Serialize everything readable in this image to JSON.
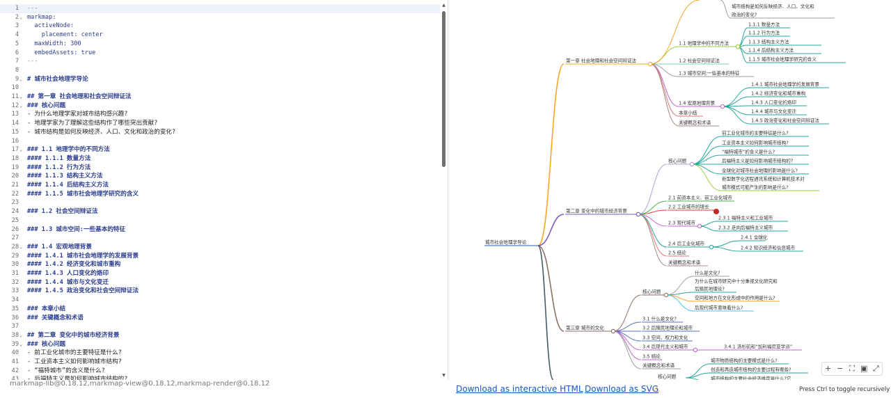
{
  "editor": {
    "lines": [
      {
        "n": "1",
        "fold": "",
        "parts": [
          [
            "dash",
            "---"
          ]
        ]
      },
      {
        "n": "2",
        "fold": "⌄",
        "parts": [
          [
            "yk",
            "markmap:"
          ]
        ]
      },
      {
        "n": "3",
        "fold": "",
        "parts": [
          [
            "yk",
            "  activeNode:"
          ]
        ]
      },
      {
        "n": "4",
        "fold": "",
        "parts": [
          [
            "yk",
            "    placement: center"
          ]
        ]
      },
      {
        "n": "5",
        "fold": "",
        "parts": [
          [
            "yk",
            "  maxWidth: 300"
          ]
        ]
      },
      {
        "n": "6",
        "fold": "",
        "parts": [
          [
            "yk",
            "  embedAssets: true"
          ]
        ]
      },
      {
        "n": "7",
        "fold": "",
        "parts": [
          [
            "dash",
            "---"
          ]
        ]
      },
      {
        "n": "8",
        "fold": "",
        "parts": []
      },
      {
        "n": "9",
        "fold": "⌄",
        "parts": [
          [
            "hd",
            "# 城市社会地理学导论"
          ]
        ]
      },
      {
        "n": "10",
        "fold": "",
        "parts": []
      },
      {
        "n": "11",
        "fold": "⌄",
        "parts": [
          [
            "hd",
            "## 第一章 社会地理和社会空间辩证法"
          ]
        ]
      },
      {
        "n": "12",
        "fold": "⌄",
        "parts": [
          [
            "hd",
            "### 核心问题"
          ]
        ]
      },
      {
        "n": "13",
        "fold": "",
        "parts": [
          [
            "txt",
            "- 为什么地理学家对城市结构感兴趣?"
          ]
        ]
      },
      {
        "n": "14",
        "fold": "",
        "parts": [
          [
            "txt",
            "- 地理学家为了理解这些结构作了哪些突出贡献?"
          ]
        ]
      },
      {
        "n": "15",
        "fold": "",
        "parts": [
          [
            "txt",
            "- 城市结构是如何反映经济、人口、文化和政治的变化?"
          ]
        ]
      },
      {
        "n": "16",
        "fold": "",
        "parts": []
      },
      {
        "n": "17",
        "fold": "⌄",
        "parts": [
          [
            "hd",
            "### 1.1 地理学中的不同方法"
          ]
        ]
      },
      {
        "n": "18",
        "fold": "",
        "parts": [
          [
            "hd",
            "#### 1.1.1 数量方法"
          ]
        ]
      },
      {
        "n": "19",
        "fold": "",
        "parts": [
          [
            "hd",
            "#### 1.1.2 行为方法"
          ]
        ]
      },
      {
        "n": "20",
        "fold": "",
        "parts": [
          [
            "hd",
            "#### 1.1.3 结构主义方法"
          ]
        ]
      },
      {
        "n": "21",
        "fold": "",
        "parts": [
          [
            "hd",
            "#### 1.1.4 后结构主义方法"
          ]
        ]
      },
      {
        "n": "22",
        "fold": "",
        "parts": [
          [
            "hd",
            "#### 1.1.5 城市社会地理学研究的含义"
          ]
        ]
      },
      {
        "n": "23",
        "fold": "",
        "parts": []
      },
      {
        "n": "24",
        "fold": "",
        "parts": [
          [
            "hd",
            "### 1.2 社会空间辩证法"
          ]
        ]
      },
      {
        "n": "25",
        "fold": "",
        "parts": []
      },
      {
        "n": "26",
        "fold": "",
        "parts": [
          [
            "hd",
            "### 1.3 城市空间:一些基本的特征"
          ]
        ]
      },
      {
        "n": "27",
        "fold": "",
        "parts": []
      },
      {
        "n": "28",
        "fold": "⌄",
        "parts": [
          [
            "hd",
            "### 1.4 宏观地理背景"
          ]
        ]
      },
      {
        "n": "29",
        "fold": "",
        "parts": [
          [
            "hd",
            "#### 1.4.1 城市社会地理学的发展背景"
          ]
        ]
      },
      {
        "n": "30",
        "fold": "",
        "parts": [
          [
            "hd",
            "#### 1.4.2 经济变化和城市重构"
          ]
        ]
      },
      {
        "n": "31",
        "fold": "",
        "parts": [
          [
            "hd",
            "#### 1.4.3 人口变化的烙印"
          ]
        ]
      },
      {
        "n": "32",
        "fold": "",
        "parts": [
          [
            "hd",
            "#### 1.4.4 城市与文化变迁"
          ]
        ]
      },
      {
        "n": "33",
        "fold": "",
        "parts": [
          [
            "hd",
            "#### 1.4.5 政治变化和社会空间辩证法"
          ]
        ]
      },
      {
        "n": "34",
        "fold": "",
        "parts": []
      },
      {
        "n": "35",
        "fold": "",
        "parts": [
          [
            "hd",
            "### 本章小结"
          ]
        ]
      },
      {
        "n": "36",
        "fold": "",
        "parts": [
          [
            "hd",
            "### 关键概念和术语"
          ]
        ]
      },
      {
        "n": "37",
        "fold": "",
        "parts": []
      },
      {
        "n": "38",
        "fold": "⌄",
        "parts": [
          [
            "hd",
            "## 第二章 变化中的城市经济背景"
          ]
        ]
      },
      {
        "n": "39",
        "fold": "⌄",
        "parts": [
          [
            "hd",
            "### 核心问题"
          ]
        ]
      },
      {
        "n": "40",
        "fold": "",
        "parts": [
          [
            "txt",
            "- 前工业化城市的主要特征是什么?"
          ]
        ]
      },
      {
        "n": "41",
        "fold": "",
        "parts": [
          [
            "txt",
            "- 工业资本主义如何影响城市结构?"
          ]
        ]
      },
      {
        "n": "42",
        "fold": "",
        "parts": [
          [
            "txt",
            "- “福特城市”的含义是什么?"
          ]
        ]
      },
      {
        "n": "43",
        "fold": "",
        "parts": [
          [
            "txt",
            "- 后福特主义是如何影响城市结构的?"
          ]
        ]
      }
    ]
  },
  "mindmap": {
    "root": "城市社会地理学导论",
    "ch1": "第一章 社会地理和社会空间辩证法",
    "ch1_q3": "城市结构是如何反映经济、人口、文化和",
    "ch1_q3b": "政治的变化?",
    "s11": "1.1 地理学中的不同方法",
    "s111": "1.1.1 数量方法",
    "s112": "1.1.2 行为方法",
    "s113": "1.1.3 结构主义方法",
    "s114": "1.1.4 后结构主义方法",
    "s115": "1.1.5 城市社会地理学研究的含义",
    "s12": "1.2 社会空间辩证法",
    "s13": "1.3 城市空间:一些基本的特征",
    "s14": "1.4 宏观地理背景",
    "s141": "1.4.1 城市社会地理学的发展背景",
    "s142": "1.4.2 经济变化和城市重构",
    "s143": "1.4.3 人口变化的烙印",
    "s144": "1.4.4 城市与文化变迁",
    "s145": "1.4.5 政治变化和社会空间辩证法",
    "s1sum": "本章小结",
    "s1key": "关键概念和术语",
    "ch2": "第二章 变化中的城市经济背景",
    "c2core": "核心问题",
    "c2q1": "前工业化城市的主要特征是什么?",
    "c2q2": "工业资本主义如何影响城市结构?",
    "c2q3": "“福特城市”的含义是什么?",
    "c2q4": "后福特主义是如何影响城市结构的?",
    "c2q5": "全球化对城市社会地理的影响是什么?",
    "c2q6a": "新型数字化远程通讯系统和计算机技术对",
    "c2q6b": "城市模式可能产生的影响是什么?",
    "s21": "2.1 前资本主义、前工业化城市",
    "s22": "2.2 工业城市的增长",
    "s23": "2.3 现代城市",
    "s231": "2.3.1 福特主义和工业城市",
    "s232": "2.3.2 走向后福特主义城市",
    "s24": "2.4 后工业化城市",
    "s241": "2.4.1 全球化",
    "s242": "2.4.2 知识经济和信息城市",
    "s25": "2.5 结论",
    "s2key": "关键概念和术语",
    "ch3": "第三章 城市的文化",
    "c3core": "核心问题",
    "c3q1": "什么是文化?",
    "c3q2a": "为什么在城市研究中十分重视文化研究和",
    "c3q2b": "后殖民地理论?",
    "c3q3": "空间和地方在文化形成中的作用是什么?",
    "c3q4": "后现代城市意味着什么?",
    "s31": "3.1 什么是文化?",
    "s32": "3.2 后殖民地理论和城市",
    "s33": "3.3 空间、权力和文化",
    "s34": "3.4 后现代主义和城市",
    "s341": "3.4.1 洛杉矶和“加利福尼亚学派”",
    "s35": "3.5 结论",
    "s3key": "关键概念和术语",
    "c4core": "核心问题",
    "c4q1": "城市物质结构的主要模式是什么?",
    "c4q2": "创造和再造城市结构的主要过程有哪些?",
    "c4q3": "城市结构的主要社会经济维度是什么?它"
  },
  "toolbar": {
    "zoom_in": "+",
    "zoom_out": "−",
    "fit": "⛶",
    "toggle": "▣",
    "fullscreen": "⤢"
  },
  "footer": {
    "versions": "markmap-lib@0.18.12,markmap-view@0.18.12,markmap-render@0.18.12",
    "download_html": "Download as interactive HTML",
    "download_svg": "Download as SVG",
    "hint": "Press Ctrl to toggle recursively"
  },
  "colors": {
    "ch1": "#f5a623",
    "ch2": "#7e57c2",
    "ch3": "#8d6e63"
  }
}
